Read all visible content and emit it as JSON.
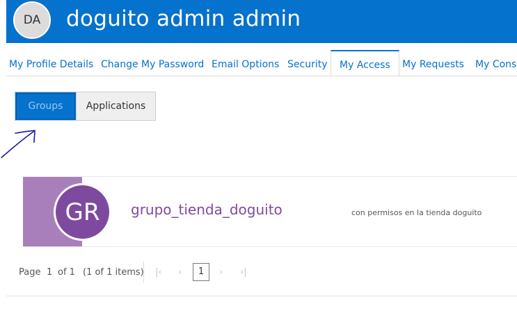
{
  "header": {
    "avatar_initials": "DA",
    "user_name": "doguito admin admin",
    "background_color": "#0572ce"
  },
  "tabs": [
    {
      "label": "My Profile Details",
      "active": false
    },
    {
      "label": "Change My Password",
      "active": false
    },
    {
      "label": "Email Options",
      "active": false
    },
    {
      "label": "Security",
      "active": false
    },
    {
      "label": "My Access",
      "active": true
    },
    {
      "label": "My Requests",
      "active": false
    },
    {
      "label": "My Conse",
      "active": false
    }
  ],
  "toggle": {
    "groups_label": "Groups",
    "applications_label": "Applications",
    "selected": "Groups"
  },
  "groups": [
    {
      "initials": "GR",
      "name": "grupo_tienda_doguito",
      "description": "con permisos en la tienda doguito",
      "accent_color": "#a87fbb",
      "avatar_color": "#7e4a9f"
    }
  ],
  "pager": {
    "page_label": "Page",
    "current_page": "1",
    "of_label": "of 1",
    "items_summary": "(1 of 1 items)",
    "current_page_button": "1",
    "first_icon": "first-page-icon",
    "prev_icon": "previous-page-icon",
    "next_icon": "next-page-icon",
    "last_icon": "last-page-icon"
  },
  "annotation": {
    "icon": "hand-drawn-arrow-icon",
    "color": "#1a1aa8"
  }
}
